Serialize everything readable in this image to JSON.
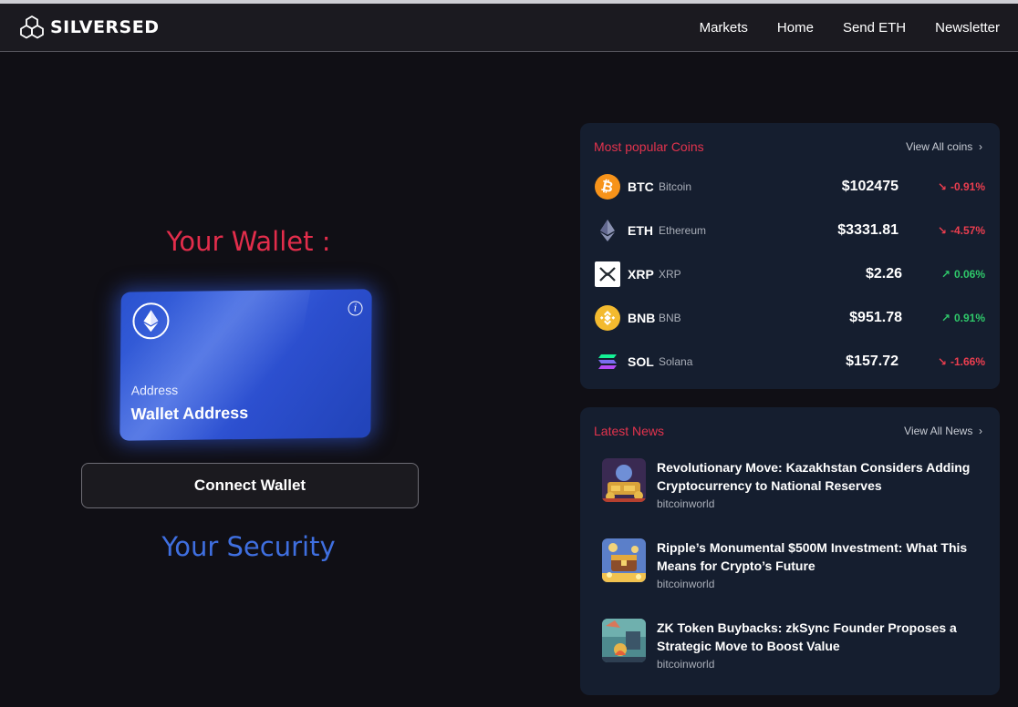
{
  "brand": {
    "name": "SILVERSED"
  },
  "nav": [
    "Markets",
    "Home",
    "Send ETH",
    "Newsletter"
  ],
  "wallet": {
    "title": "Your Wallet :",
    "card_label": "Address",
    "card_value": "Wallet Address",
    "connect_label": "Connect Wallet",
    "security_title": "Your Security"
  },
  "coins": {
    "title": "Most popular Coins",
    "view_all": "View All coins",
    "items": [
      {
        "symbol": "BTC",
        "name": "Bitcoin",
        "price": "$102475",
        "change": "-0.91%",
        "direction": "down",
        "icon": "bitcoin-icon",
        "color": "#f7931a"
      },
      {
        "symbol": "ETH",
        "name": "Ethereum",
        "price": "$3331.81",
        "change": "-4.57%",
        "direction": "down",
        "icon": "ethereum-icon",
        "color": "#8a92b2"
      },
      {
        "symbol": "XRP",
        "name": "XRP",
        "price": "$2.26",
        "change": "0.06%",
        "direction": "up",
        "icon": "xrp-icon",
        "color": "#ffffff"
      },
      {
        "symbol": "BNB",
        "name": "BNB",
        "price": "$951.78",
        "change": "0.91%",
        "direction": "up",
        "icon": "bnb-icon",
        "color": "#f3ba2f"
      },
      {
        "symbol": "SOL",
        "name": "Solana",
        "price": "$157.72",
        "change": "-1.66%",
        "direction": "down",
        "icon": "solana-icon",
        "color": "#9945ff"
      }
    ]
  },
  "news": {
    "title": "Latest News",
    "view_all": "View All News",
    "items": [
      {
        "title": "Revolutionary Move: Kazakhstan Considers Adding Cryptocurrency to National Reserves",
        "source": "bitcoinworld"
      },
      {
        "title": "Ripple’s Monumental $500M Investment: What This Means for Crypto’s Future",
        "source": "bitcoinworld"
      },
      {
        "title": "ZK Token Buybacks: zkSync Founder Proposes a Strategic Move to Boost Value",
        "source": "bitcoinworld"
      }
    ]
  },
  "colors": {
    "accent_red": "#e22d4b",
    "accent_blue": "#3f6fe0",
    "positive": "#2fc86a",
    "negative": "#ec3e4f",
    "panel_bg": "#151e2f",
    "page_bg": "#100f15"
  }
}
